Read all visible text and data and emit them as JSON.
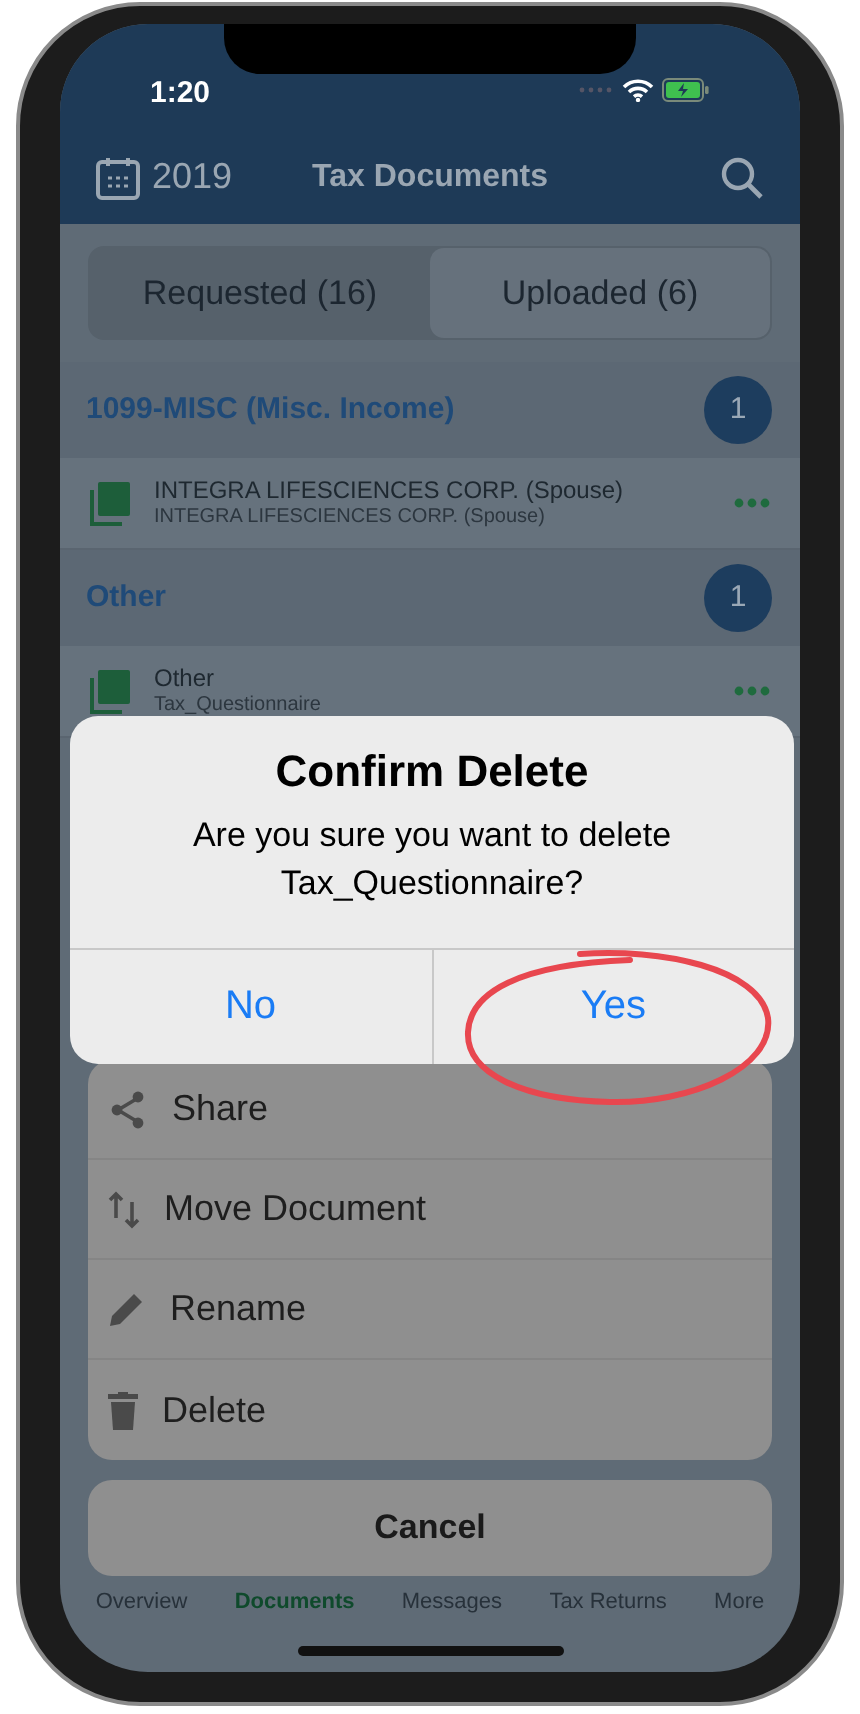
{
  "status_bar": {
    "time": "1:20"
  },
  "header": {
    "year": "2019",
    "title": "Tax Documents"
  },
  "segments": [
    {
      "label": "Requested (16)",
      "selected": false
    },
    {
      "label": "Uploaded (6)",
      "selected": true
    }
  ],
  "sections": [
    {
      "title": "1099-MISC (Misc. Income)",
      "count": "1",
      "documents": [
        {
          "name": "INTEGRA LIFESCIENCES CORP. (Spouse)",
          "subtitle": "INTEGRA LIFESCIENCES CORP. (Spouse)"
        }
      ]
    },
    {
      "title": "Other",
      "count": "1",
      "documents": [
        {
          "name": "Other",
          "subtitle": "Tax_Questionnaire"
        }
      ]
    }
  ],
  "alert": {
    "title": "Confirm Delete",
    "message": "Are you sure you want to delete Tax_Questionnaire?",
    "buttons": [
      {
        "label": "No",
        "highlighted": false
      },
      {
        "label": "Yes",
        "highlighted": true
      }
    ]
  },
  "action_sheet": {
    "items": [
      {
        "kind": "share",
        "label": "Share"
      },
      {
        "kind": "move",
        "label": "Move Document"
      },
      {
        "kind": "rename",
        "label": "Rename"
      },
      {
        "kind": "delete",
        "label": "Delete"
      }
    ],
    "cancel": "Cancel"
  },
  "tab_bar": [
    {
      "label": "Overview",
      "selected": false
    },
    {
      "label": "Documents",
      "selected": true
    },
    {
      "label": "Messages",
      "selected": false
    },
    {
      "label": "Tax Returns",
      "selected": false
    },
    {
      "label": "More",
      "selected": false
    }
  ]
}
